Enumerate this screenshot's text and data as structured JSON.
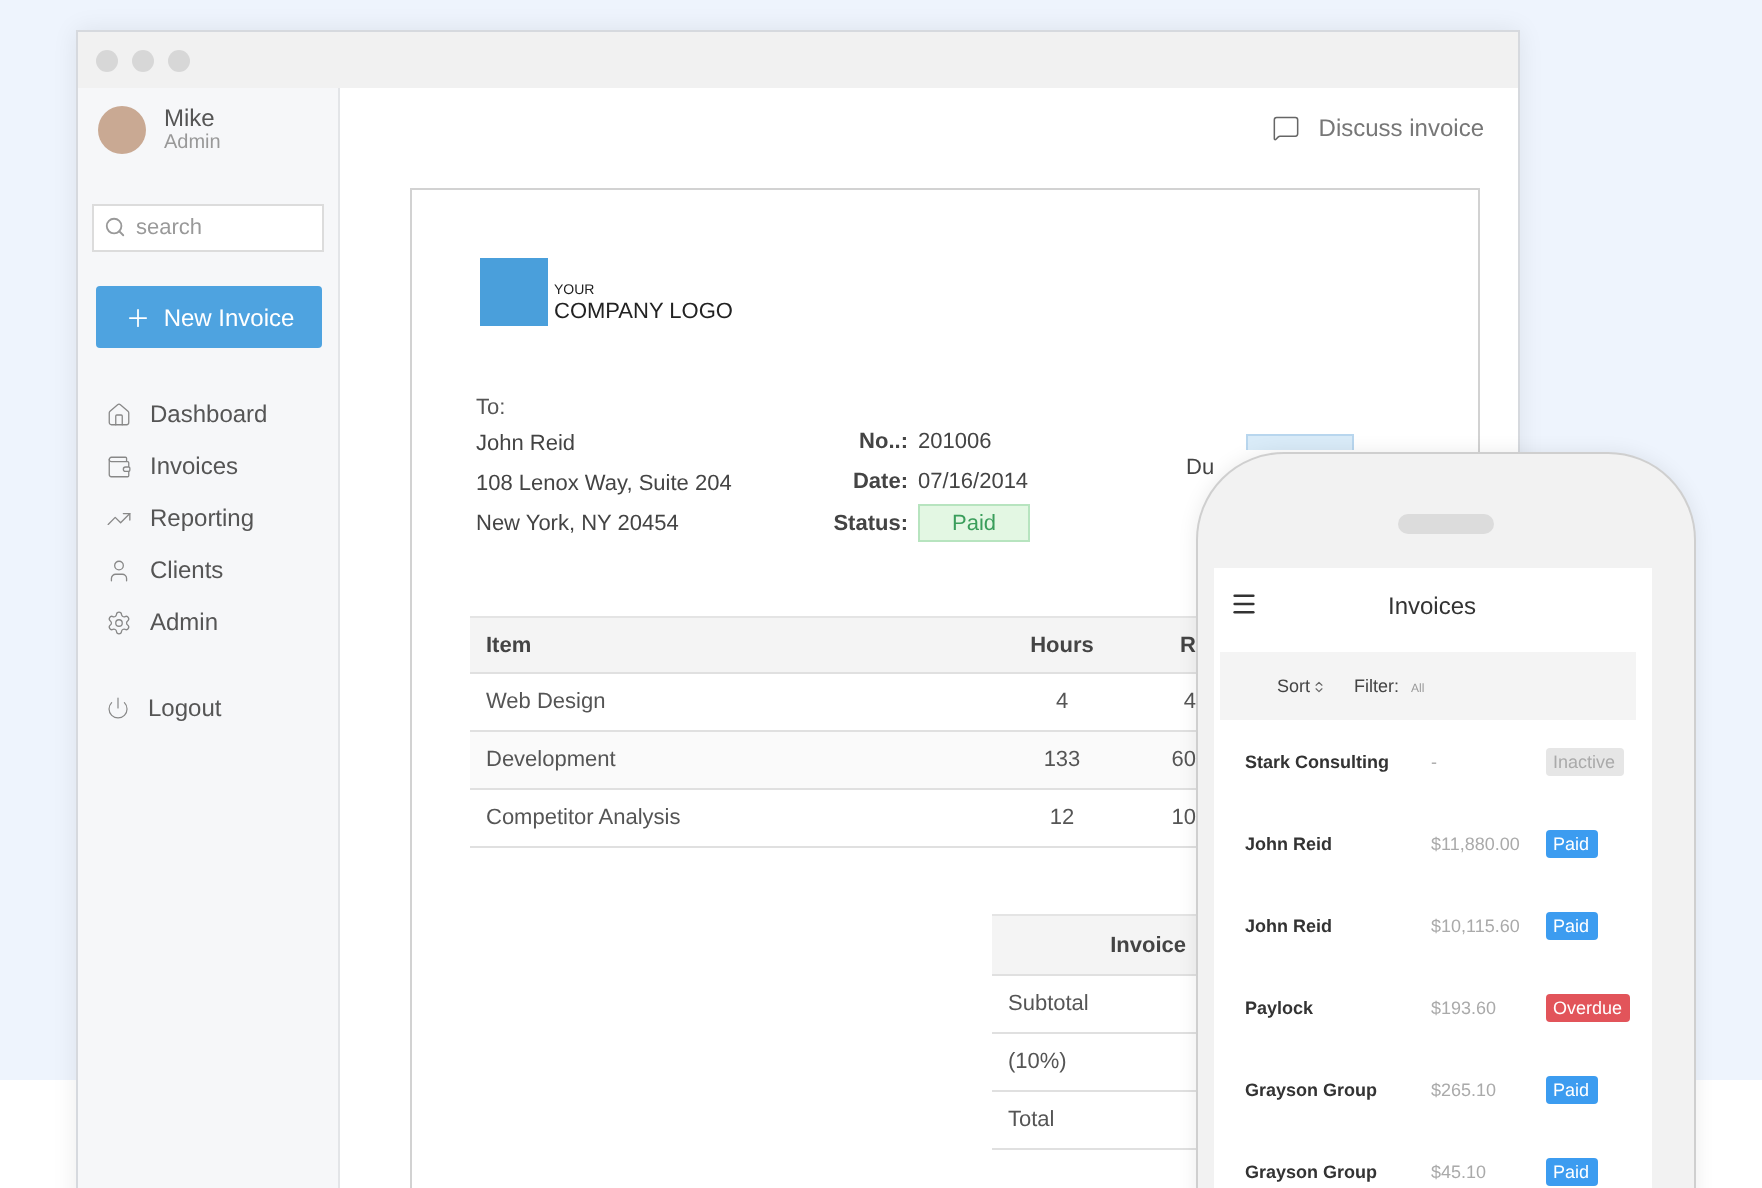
{
  "user": {
    "name": "Mike",
    "role": "Admin"
  },
  "search": {
    "placeholder": "search"
  },
  "new_invoice_button": "New Invoice",
  "nav": [
    "Dashboard",
    "Invoices",
    "Reporting",
    "Clients",
    "Admin"
  ],
  "logout": "Logout",
  "discuss": "Discuss invoice",
  "invoice": {
    "logo_small": "YOUR",
    "logo_large": "COMPANY LOGO",
    "to_label": "To:",
    "address": [
      "John Reid",
      "108 Lenox Way, Suite 204",
      "New York, NY 20454"
    ],
    "meta": [
      {
        "label": "No..:",
        "value": "201006",
        "kind": "text"
      },
      {
        "label": "Date:",
        "value": "07/16/2014",
        "kind": "text"
      },
      {
        "label": "Status:",
        "value": "Paid",
        "kind": "badge"
      }
    ],
    "due_label": "Du",
    "table": {
      "columns": [
        "Item",
        "Hours",
        "R"
      ],
      "rows": [
        [
          "Web Design",
          "4",
          "4"
        ],
        [
          "Development",
          "133",
          "60"
        ],
        [
          "Competitor Analysis",
          "12",
          "10"
        ]
      ]
    },
    "summary": {
      "header": "Invoice",
      "rows": [
        "Subtotal",
        "(10%)",
        "Total"
      ]
    }
  },
  "mobile": {
    "title": "Invoices",
    "sort": "Sort",
    "filter_label": "Filter:",
    "filter_value": "All",
    "rows": [
      {
        "client": "Stark Consulting",
        "amount": "-",
        "status": "Inactive",
        "kind": "inactive"
      },
      {
        "client": "John Reid",
        "amount": "$11,880.00",
        "status": "Paid",
        "kind": "paid"
      },
      {
        "client": "John Reid",
        "amount": "$10,115.60",
        "status": "Paid",
        "kind": "paid"
      },
      {
        "client": "Paylock",
        "amount": "$193.60",
        "status": "Overdue",
        "kind": "overdue"
      },
      {
        "client": "Grayson Group",
        "amount": "$265.10",
        "status": "Paid",
        "kind": "paid"
      },
      {
        "client": "Grayson Group",
        "amount": "$45.10",
        "status": "Paid",
        "kind": "paid"
      }
    ]
  }
}
